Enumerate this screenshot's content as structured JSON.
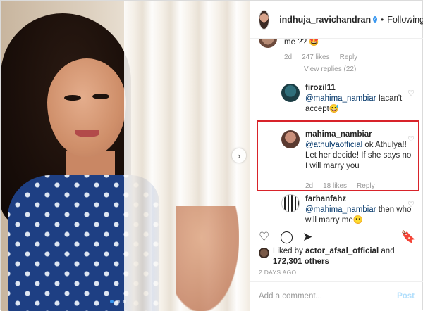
{
  "header": {
    "username": "indhuja_ravichandran",
    "verified_glyph": "✓",
    "separator": "•",
    "follow_label": "Following",
    "more_glyph": "···"
  },
  "comments": {
    "c1": {
      "text": "me ?? 🤩",
      "time": "2d",
      "likes": "247 likes",
      "reply": "Reply",
      "view_replies": "View replies (22)"
    },
    "c2": {
      "user": "firozil11",
      "mention": "@mahima_nambiar",
      "text": " Iacan't accept😅"
    },
    "c3": {
      "user": "mahima_nambiar",
      "mention": "@athulyaofficial",
      "text": " ok Athulya!! Let her decide! If she says no I will marry you",
      "time": "2d",
      "likes": "18 likes",
      "reply": "Reply"
    },
    "c4": {
      "user": "farhanfahz",
      "mention": "@mahima_nambiar",
      "text": " then who will marry me😶"
    }
  },
  "actions": {
    "like_icon": "heart-icon",
    "comment_icon": "comment-icon",
    "share_icon": "share-icon",
    "save_icon": "bookmark-icon"
  },
  "likes": {
    "prefix": "Liked by ",
    "user": "actor_afsal_official",
    "mid": " and ",
    "count": "172,301 others"
  },
  "post_time": "2 DAYS AGO",
  "add_comment": {
    "placeholder": "Add a comment...",
    "post_label": "Post"
  },
  "carousel": {
    "total_dots": 3,
    "active_dot": 1,
    "next_glyph": "›"
  },
  "colors": {
    "highlight_border": "#d8232a",
    "link_blue": "#003569",
    "post_disabled": "#b2dffc",
    "verified": "#3897f0"
  }
}
